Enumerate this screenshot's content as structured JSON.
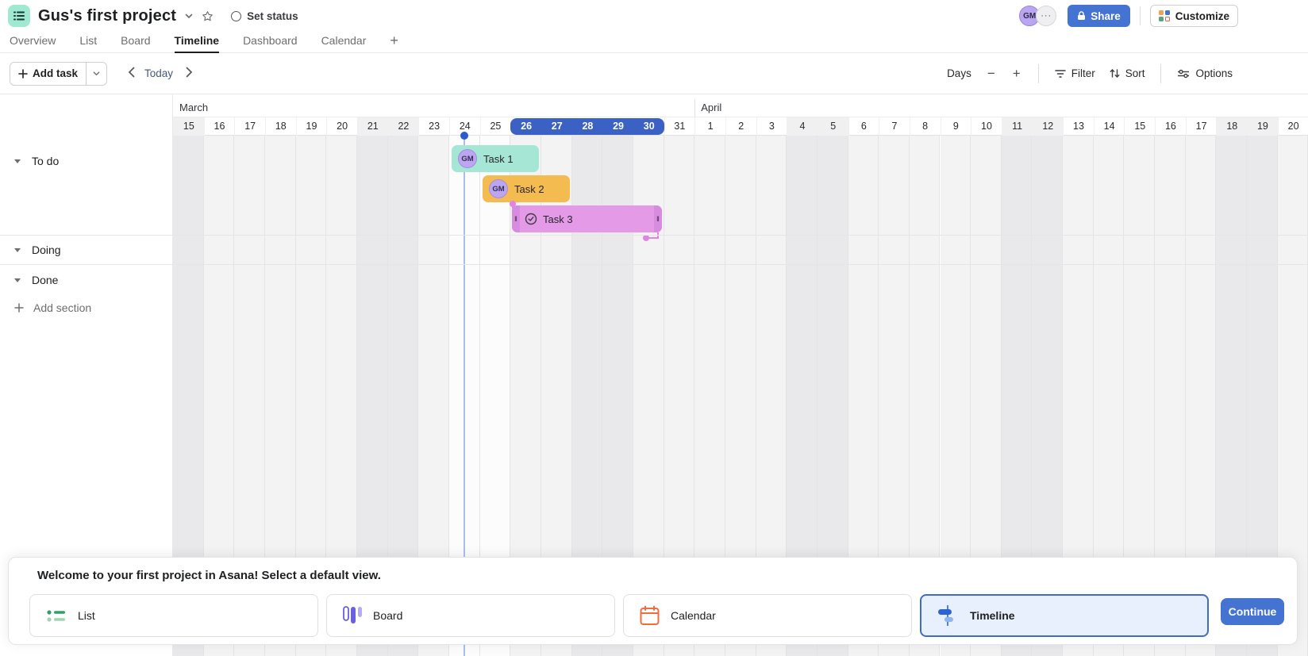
{
  "header": {
    "title": "Gus's first project",
    "set_status": "Set status",
    "avatar_initials": "GM",
    "more": "···",
    "share": "Share",
    "customize": "Customize"
  },
  "tabs": {
    "items": [
      {
        "label": "Overview",
        "active": false
      },
      {
        "label": "List",
        "active": false
      },
      {
        "label": "Board",
        "active": false
      },
      {
        "label": "Timeline",
        "active": true
      },
      {
        "label": "Dashboard",
        "active": false
      },
      {
        "label": "Calendar",
        "active": false
      }
    ],
    "add_tab": "+"
  },
  "toolbar": {
    "add_task": "Add task",
    "today": "Today",
    "zoom_level": "Days",
    "minus": "−",
    "plus": "+",
    "filter": "Filter",
    "sort": "Sort",
    "options": "Options"
  },
  "sections": {
    "items": [
      {
        "label": "To do"
      },
      {
        "label": "Doing"
      },
      {
        "label": "Done"
      }
    ],
    "add_section": "Add section"
  },
  "timeline": {
    "months": [
      {
        "name": "March",
        "days": [
          15,
          16,
          17,
          18,
          19,
          20,
          21,
          22,
          23,
          24,
          25,
          26,
          27,
          28,
          29,
          30,
          31
        ]
      },
      {
        "name": "April",
        "days": [
          1,
          2,
          3,
          4,
          5,
          6,
          7,
          8,
          9,
          10,
          11,
          12,
          13,
          14,
          15,
          16,
          17,
          18,
          19,
          20
        ]
      }
    ],
    "weekend_indices": [
      0,
      6,
      7,
      13,
      14,
      20,
      21,
      27,
      28,
      34,
      35
    ],
    "white_indices": [
      9,
      10
    ],
    "selected_range": {
      "start_index": 11,
      "end_index": 15,
      "labels": [
        26,
        27,
        28,
        29,
        30
      ],
      "color": "#3b61c4"
    },
    "today_index": 9,
    "today_color": "#2d5bc9",
    "tasks": [
      {
        "name": "Task 1",
        "assignee": "GM",
        "start_day": "March 24",
        "end_day": "March 26",
        "color": "#a5e6d4"
      },
      {
        "name": "Task 2",
        "assignee": "GM",
        "start_day": "March 25",
        "end_day": "March 27",
        "color": "#f4bb51"
      },
      {
        "name": "Task 3",
        "start_day": "March 26",
        "end_day": "March 30",
        "color": "#e49ae7",
        "selected": true
      }
    ],
    "dependency_color": "#e184e3"
  },
  "banner": {
    "message": "Welcome to your first project in Asana! Select a default view.",
    "views": [
      {
        "label": "List",
        "selected": false
      },
      {
        "label": "Board",
        "selected": false
      },
      {
        "label": "Calendar",
        "selected": false
      },
      {
        "label": "Timeline",
        "selected": true
      }
    ],
    "continue_label": "Continue"
  },
  "colors": {
    "accent": "#4573d2",
    "selection_pill": "#3b61c4",
    "mint": "#9fe8d2"
  }
}
